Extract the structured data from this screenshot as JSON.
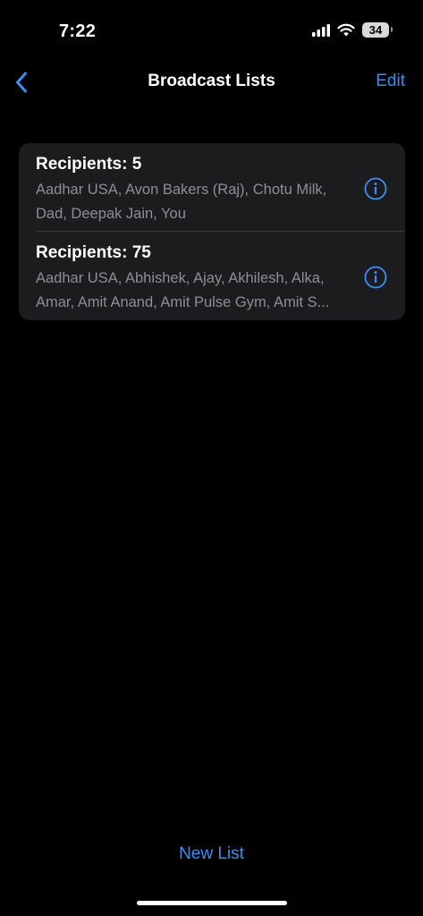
{
  "status_bar": {
    "time": "7:22",
    "battery_level": "34",
    "icons": [
      "cellular-signal-icon",
      "wifi-icon",
      "battery-icon"
    ]
  },
  "nav": {
    "back_icon": "chevron-left-icon",
    "title": "Broadcast Lists",
    "edit_label": "Edit"
  },
  "lists": [
    {
      "title": "Recipients: 5",
      "members": "Aadhar USA, Avon Bakers (Raj), Chotu Milk, Dad, Deepak Jain, You",
      "info_icon": "info-circle-icon"
    },
    {
      "title": "Recipients: 75",
      "members": "Aadhar USA, Abhishek, Ajay, Akhilesh, Alka, Amar, Amit Anand, Amit Pulse Gym, Amit S...",
      "info_icon": "info-circle-icon"
    }
  ],
  "footer": {
    "new_list_label": "New List"
  },
  "colors": {
    "background": "#000000",
    "card": "#1c1c1e",
    "accent": "#3a8ef6",
    "secondary_text": "#8e8e93"
  }
}
